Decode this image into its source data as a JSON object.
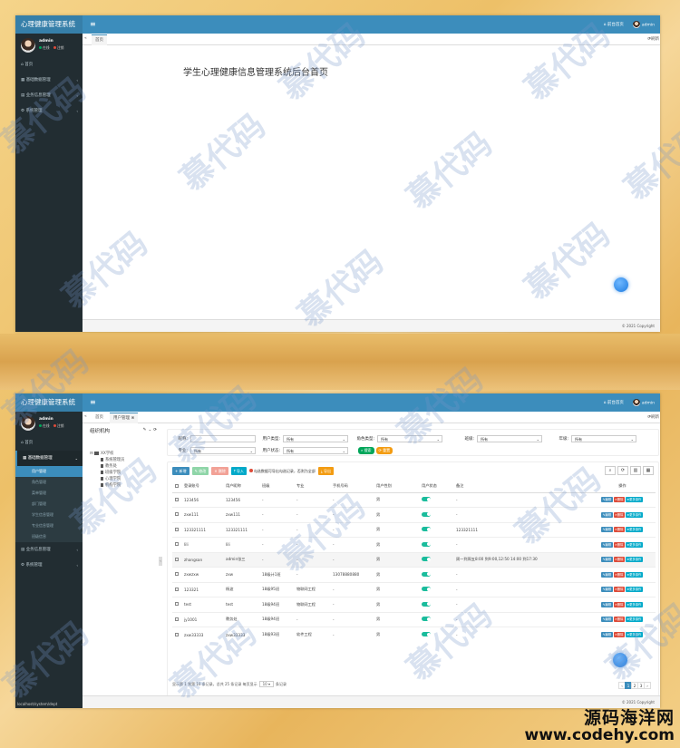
{
  "app": {
    "title": "心理健康管理系统",
    "home_link": "前台首页",
    "user": "admin",
    "copyright": "© 2021 Copyright"
  },
  "sidebar": {
    "user_name": "admin",
    "status_online": "在线",
    "status_logout": "注销",
    "home": "首页",
    "basic_data": "基础数据管理",
    "business_info": "业务信息管理",
    "system_mgmt": "系统管理",
    "sub_items": [
      "用户管理",
      "角色管理",
      "菜单管理",
      "部门管理",
      "学生信息管理",
      "专业信息管理",
      "班级信息"
    ]
  },
  "screen1": {
    "tab_home": "首页",
    "refresh": "刷新",
    "welcome": "学生心理健康信息管理系统后台首页"
  },
  "screen2": {
    "tab_home": "首页",
    "tab_users": "用户管理",
    "refresh": "刷新",
    "tree_title": "组织机构",
    "tree_root": "XX学校",
    "tree_leaves": [
      "系统管理员",
      "教务处",
      "班级学院",
      "心理学院",
      "机构学院"
    ],
    "filters": {
      "nickname_label": "昵称:",
      "usertype_label": "用户类型:",
      "usertype_value": "所有",
      "roletype_label": "角色类型:",
      "roletype_value": "所有",
      "class_label": "班级:",
      "class_value": "所有",
      "grade_label": "年级:",
      "grade_value": "所有",
      "major_label": "专业:",
      "major_value": "所有",
      "status_label": "用户状态:",
      "status_value": "所有",
      "search_btn": "搜索",
      "reset_btn": "重置"
    },
    "toolbar": {
      "add": "新增",
      "edit": "修改",
      "delete": "删除",
      "import": "导入",
      "hint": "勾选数据可导出勾选记录，否则为全部",
      "export": "导出"
    },
    "columns": [
      "登录账号",
      "用户昵称",
      "班级",
      "专业",
      "手机号码",
      "用户性别",
      "用户状态",
      "备注",
      "操作"
    ],
    "rows": [
      [
        "123456",
        "123456",
        "-",
        "-",
        "-",
        "男",
        "",
        "-"
      ],
      [
        "zxw111",
        "zxw111",
        "-",
        "-",
        "-",
        "男",
        "",
        "-"
      ],
      [
        "123321111",
        "123321111",
        "-",
        "-",
        "-",
        "男",
        "",
        "123321111"
      ],
      [
        "lili",
        "lili",
        "-",
        "-",
        "-",
        "男",
        "",
        "-"
      ],
      [
        "zhangsan",
        "admin张三",
        "-",
        "-",
        "-",
        "男",
        "",
        "周一到周五8:00 到9:00,12:50 14:00 到17:30"
      ],
      [
        "zxwzxw",
        "zxw",
        "18级计1班",
        "-",
        "13078880880",
        "男",
        "",
        "-"
      ],
      [
        "123321",
        "杨波",
        "18级95班",
        "物联网工程",
        "-",
        "男",
        "",
        "-"
      ],
      [
        "test",
        "test",
        "18级94班",
        "物联网工程",
        "-",
        "男",
        "",
        "-"
      ],
      [
        "jy1001",
        "教务处",
        "18级94班",
        "-",
        "-",
        "男",
        "",
        "-"
      ],
      [
        "zxw33333",
        "zxw33333",
        "18级93班",
        "软件工程",
        "-",
        "男",
        "",
        "-"
      ]
    ],
    "row_actions": [
      "编辑",
      "删除",
      "更多操作"
    ],
    "pager": {
      "summary": "显示第 1 到第 10 条记录，总共 25 条记录 每页显示",
      "page_size": "10",
      "suffix": "条记录",
      "pages": [
        "‹",
        "1",
        "2",
        "3",
        "›"
      ]
    },
    "status_url": "localhost/system/dept"
  },
  "watermark": {
    "text": "慕代码",
    "site_cn": "源码海洋网",
    "site_url": "www.codehy.com"
  },
  "colors": {
    "header": "#3c8dbc",
    "sidebar": "#222d32",
    "success": "#00a65a",
    "danger": "#dd4b39",
    "warning": "#f39c12",
    "primary": "#3c8dbc",
    "info": "#00c0ef"
  }
}
